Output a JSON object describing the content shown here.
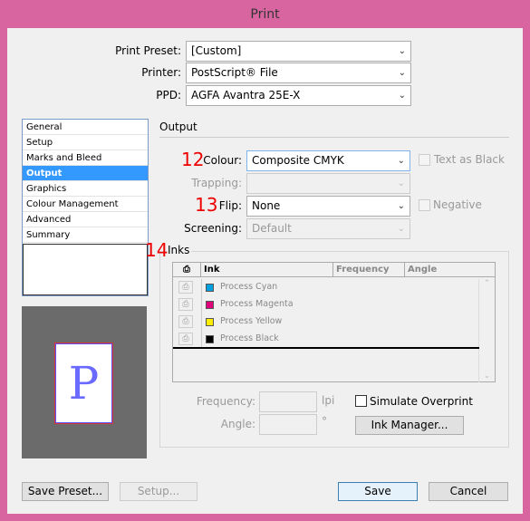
{
  "window": {
    "title": "Print"
  },
  "top": {
    "preset": {
      "label": "Print Preset:",
      "value": "[Custom]"
    },
    "printer": {
      "label": "Printer:",
      "value": "PostScript® File"
    },
    "ppd": {
      "label": "PPD:",
      "value": "AGFA Avantra 25E-X"
    }
  },
  "sidebar": {
    "items": [
      {
        "label": "General"
      },
      {
        "label": "Setup"
      },
      {
        "label": "Marks and Bleed"
      },
      {
        "label": "Output",
        "selected": true
      },
      {
        "label": "Graphics"
      },
      {
        "label": "Colour Management"
      },
      {
        "label": "Advanced"
      },
      {
        "label": "Summary"
      }
    ]
  },
  "preview": {
    "glyph": "P"
  },
  "output": {
    "heading": "Output",
    "colour": {
      "num": "12",
      "label": "Colour:",
      "value": "Composite CMYK"
    },
    "text_as_black": "Text as Black",
    "trapping": {
      "label": "Trapping:",
      "value": ""
    },
    "flip": {
      "num": "13",
      "label": "Flip:",
      "value": "None"
    },
    "negative": "Negative",
    "screening": {
      "label": "Screening:",
      "value": "Default"
    }
  },
  "inks": {
    "num": "14",
    "label": "Inks",
    "columns": [
      "Ink",
      "Frequency",
      "Angle"
    ],
    "rows": [
      {
        "name": "Process Cyan",
        "color": "#00a0e0"
      },
      {
        "name": "Process Magenta",
        "color": "#e0007a"
      },
      {
        "name": "Process Yellow",
        "color": "#ffee00"
      },
      {
        "name": "Process Black",
        "color": "#000000"
      }
    ],
    "frequency_label": "Frequency:",
    "frequency_unit": "lpi",
    "angle_label": "Angle:",
    "angle_unit": "°",
    "simulate_overprint": "Simulate Overprint",
    "ink_manager": "Ink Manager..."
  },
  "buttons": {
    "save_preset": "Save Preset...",
    "setup": "Setup...",
    "save": "Save",
    "cancel": "Cancel"
  }
}
